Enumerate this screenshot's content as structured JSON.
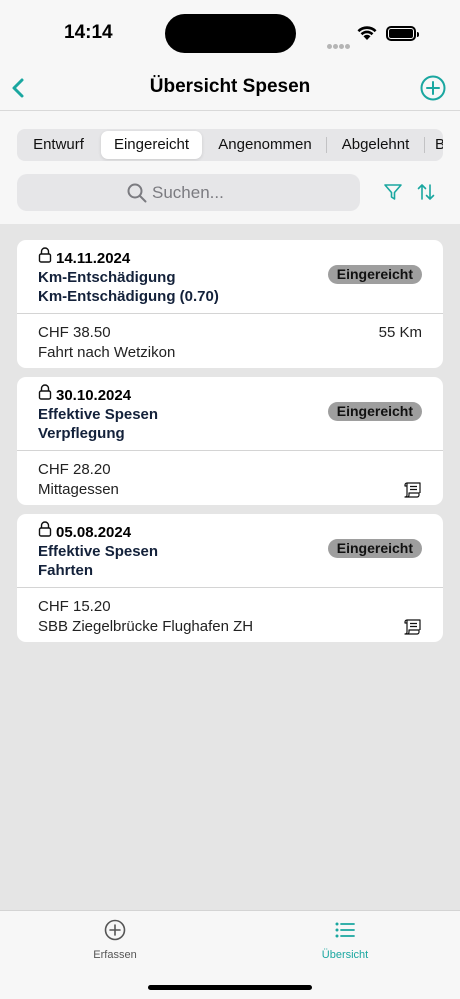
{
  "status": {
    "time": "14:14"
  },
  "nav": {
    "title": "Übersicht Spesen",
    "back_icon": "chevron-left-icon",
    "add_icon": "plus-circle-icon",
    "accent": "#1aa7a0"
  },
  "segments": [
    {
      "label": "Entwurf",
      "active": false
    },
    {
      "label": "Eingereicht",
      "active": true
    },
    {
      "label": "Angenommen",
      "active": false
    },
    {
      "label": "Abgelehnt",
      "active": false
    },
    {
      "label": "B",
      "active": false
    }
  ],
  "search": {
    "placeholder": "Suchen..."
  },
  "cards": [
    {
      "date": "14.11.2024",
      "type": "Km-Entschädigung",
      "category": "Km-Entschädigung (0.70)",
      "status": "Eingereicht",
      "amount": "CHF 38.50",
      "description": "Fahrt nach Wetzikon",
      "extra": "55 Km",
      "has_receipt": false
    },
    {
      "date": "30.10.2024",
      "type": "Effektive Spesen",
      "category": "Verpflegung",
      "status": "Eingereicht",
      "amount": "CHF 28.20",
      "description": "Mittagessen",
      "extra": "",
      "has_receipt": true
    },
    {
      "date": "05.08.2024",
      "type": "Effektive Spesen",
      "category": "Fahrten",
      "status": "Eingereicht",
      "amount": "CHF 15.20",
      "description": "SBB Ziegelbrücke Flughafen ZH",
      "extra": "",
      "has_receipt": true
    }
  ],
  "tabbar": {
    "items": [
      {
        "label": "Erfassen",
        "icon": "plus-circle-icon",
        "active": false
      },
      {
        "label": "Übersicht",
        "icon": "list-icon",
        "active": true
      }
    ]
  }
}
